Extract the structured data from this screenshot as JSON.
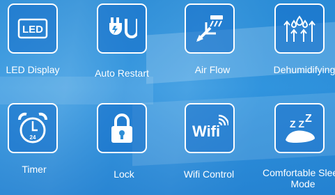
{
  "features": [
    {
      "label": "LED Display",
      "icon": "led-display-icon"
    },
    {
      "label": "Auto Restart",
      "icon": "auto-restart-icon"
    },
    {
      "label": "Air Flow",
      "icon": "air-flow-icon"
    },
    {
      "label": "Dehumidifying",
      "icon": "dehumidifying-icon"
    },
    {
      "label": "Timer",
      "icon": "timer-icon"
    },
    {
      "label": "Lock",
      "icon": "lock-icon"
    },
    {
      "label": "Wifi Control",
      "icon": "wifi-icon"
    },
    {
      "label": "Comfortable Sleep Mode",
      "icon": "sleep-icon"
    }
  ],
  "icon_text": {
    "led": "LED",
    "timer": "24",
    "wifi": "Wifi",
    "sleep": "Z Z"
  },
  "colors": {
    "accent": "#2f8fd6",
    "icon": "#ffffff"
  }
}
